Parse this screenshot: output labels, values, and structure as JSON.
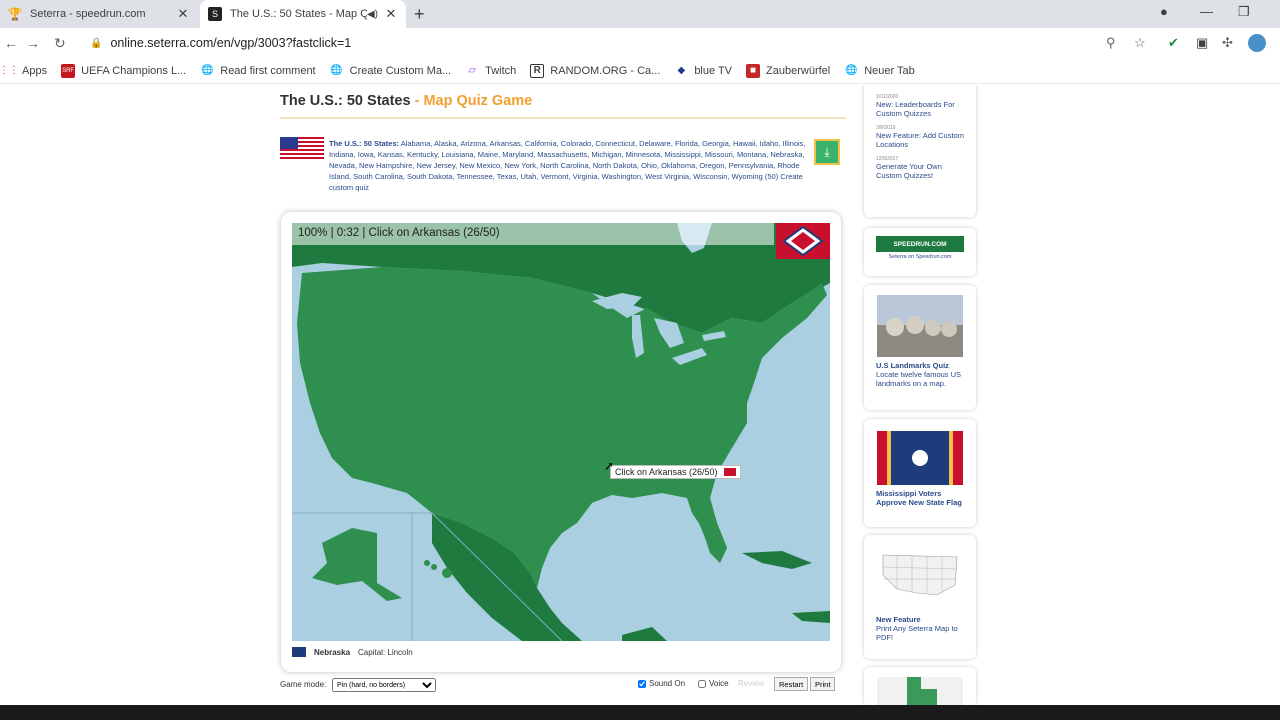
{
  "browser": {
    "tabs": [
      {
        "title": "Seterra - speedrun.com",
        "active": false
      },
      {
        "title": "The U.S.: 50 States - Map Qu",
        "active": true
      }
    ],
    "url": "online.seterra.com/en/vgp/3003?fastclick=1",
    "bookmarks": [
      "Apps",
      "UEFA Champions L...",
      "Read first comment",
      "Create Custom Ma...",
      "Twitch",
      "RANDOM.ORG - Ca...",
      "blue TV",
      "Zauberwürfel",
      "Neuer Tab"
    ]
  },
  "page": {
    "title": "The U.S.: 50 States",
    "title_sep": " - ",
    "subtitle": "Map Quiz Game",
    "desc_head": "The U.S.: 50 States:",
    "desc_body": "Alabama, Alaska, Arizona, Arkansas, California, Colorado, Connecticut, Delaware, Florida, Georgia, Hawaii, Idaho, Illinois, Indiana, Iowa, Kansas, Kentucky, Louisiana, Maine, Maryland, Massachusetts, Michigan, Minnesota, Mississippi, Missouri, Montana, Nebraska, Nevada, New Hampshire, New Jersey, New Mexico, New York, North Carolina, North Dakota, Ohio, Oklahoma, Oregon, Pennsylvania, Rhode Island, South Carolina, South Dakota, Tennessee, Texas, Utah, Vermont, Virginia, Washington, West Virginia, Wisconsin, Wyoming (50)",
    "create_custom": "Create custom quiz"
  },
  "game": {
    "status": "100% | 0:32 | Click on Arkansas (26/50)",
    "tooltip": "Click on Arkansas (26/50)",
    "last_state": "Nebraska",
    "last_capital": "Capital: Lincoln",
    "mode_label": "Game mode:",
    "mode_value": "Pin (hard, no borders)",
    "sound_label": "Sound On",
    "voice_label": "Voice",
    "review_label": "Review",
    "restart_label": "Restart",
    "print_label": "Print"
  },
  "sidebar": {
    "news": [
      {
        "date": "1/31/2020",
        "text": "New: Leaderboards For Custom Quizzes"
      },
      {
        "date": "3/8/2019",
        "text": "New Feature: Add Custom Locations"
      },
      {
        "date": "12/6/2017",
        "text": "Generate Your Own Custom Quizzes!"
      }
    ],
    "speedrun_caption": "Seterra on Speedrun.com",
    "landmarks_title": "U.S Landmarks Quiz",
    "landmarks_body": "Locate twelve famous US landmarks on a map.",
    "mississippi_title": "Mississippi Voters Approve New State Flag",
    "feature_title": "New Feature",
    "feature_body": "Print Any Seterra Map to PDF!"
  },
  "colors": {
    "map_green": "#2f8f4e",
    "map_dark": "#1f7a40",
    "water": "#a9cfe0",
    "accent": "#f0a030"
  }
}
